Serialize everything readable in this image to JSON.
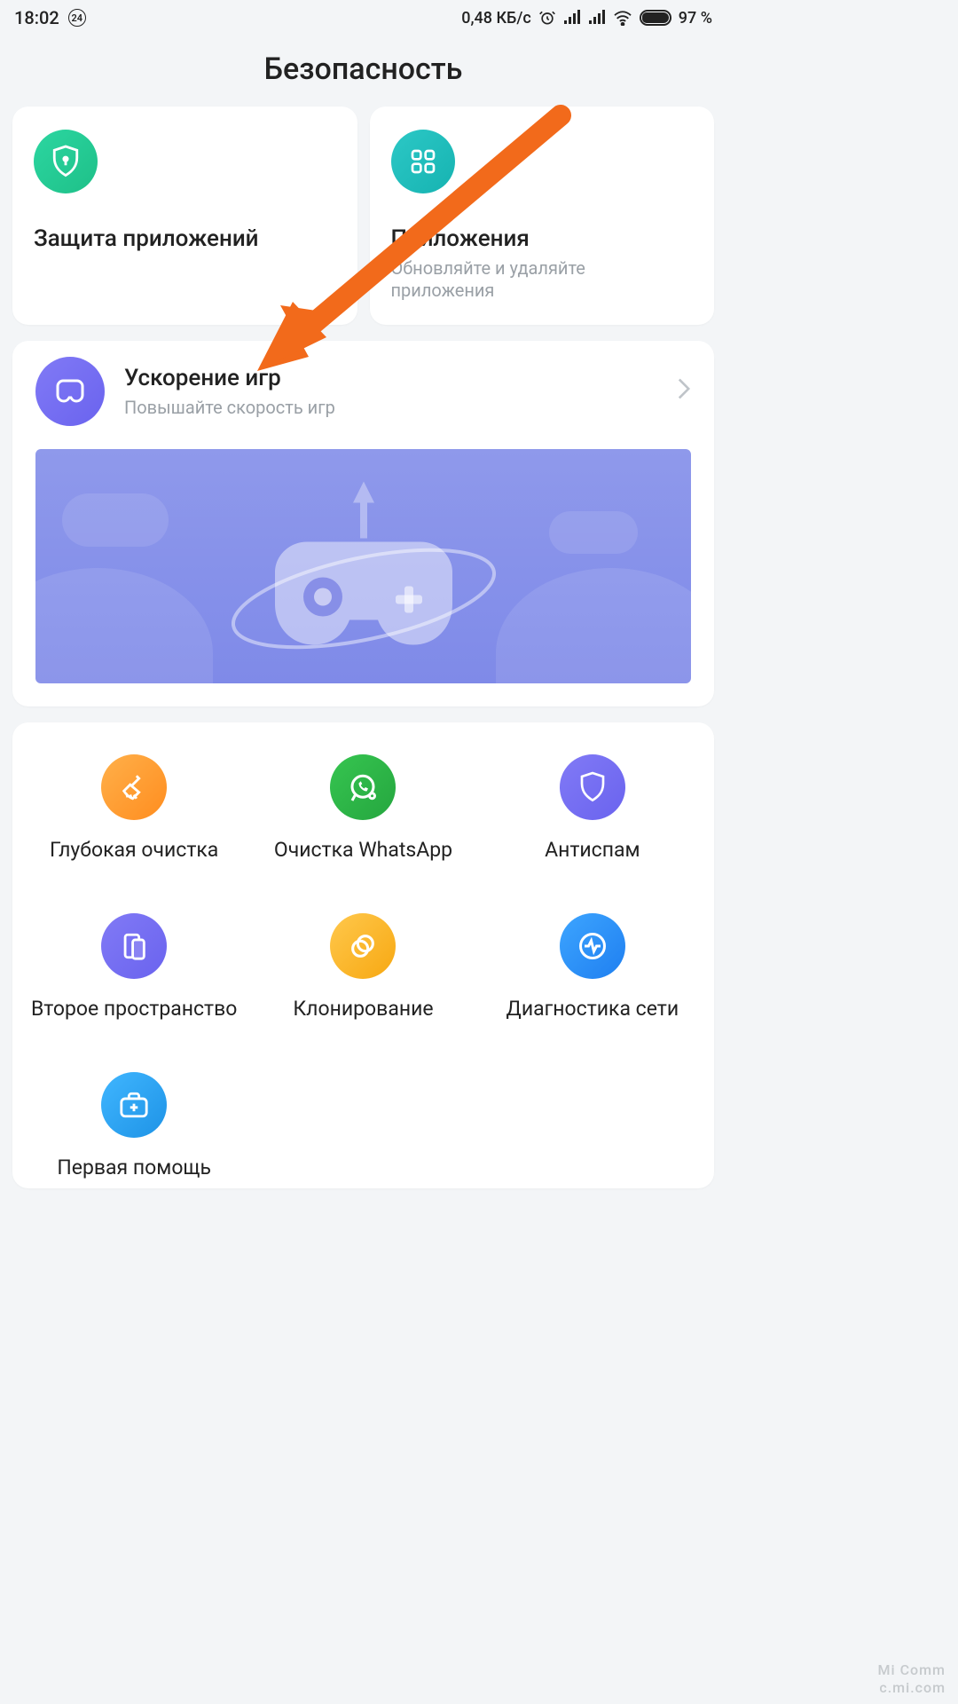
{
  "status": {
    "time": "18:02",
    "badge": "24",
    "speed": "0,48 КБ/с",
    "battery_pct": "97 %"
  },
  "title": "Безопасность",
  "topCards": [
    {
      "title": "Защита приложений",
      "sub": ""
    },
    {
      "title": "Приложения",
      "sub": "Обновляйте и удаляйте приложения"
    }
  ],
  "game": {
    "title": "Ускорение игр",
    "sub": "Повышайте скорость игр"
  },
  "gridItems": [
    {
      "label": "Глубокая очистка"
    },
    {
      "label": "Очистка WhatsApp"
    },
    {
      "label": "Антиспам"
    },
    {
      "label": "Второе пространство"
    },
    {
      "label": "Клонирование"
    },
    {
      "label": "Диагностика сети"
    },
    {
      "label": "Первая помощь"
    }
  ],
  "watermark": {
    "line1": "Mi Comm",
    "line2": "c.mi.com"
  }
}
